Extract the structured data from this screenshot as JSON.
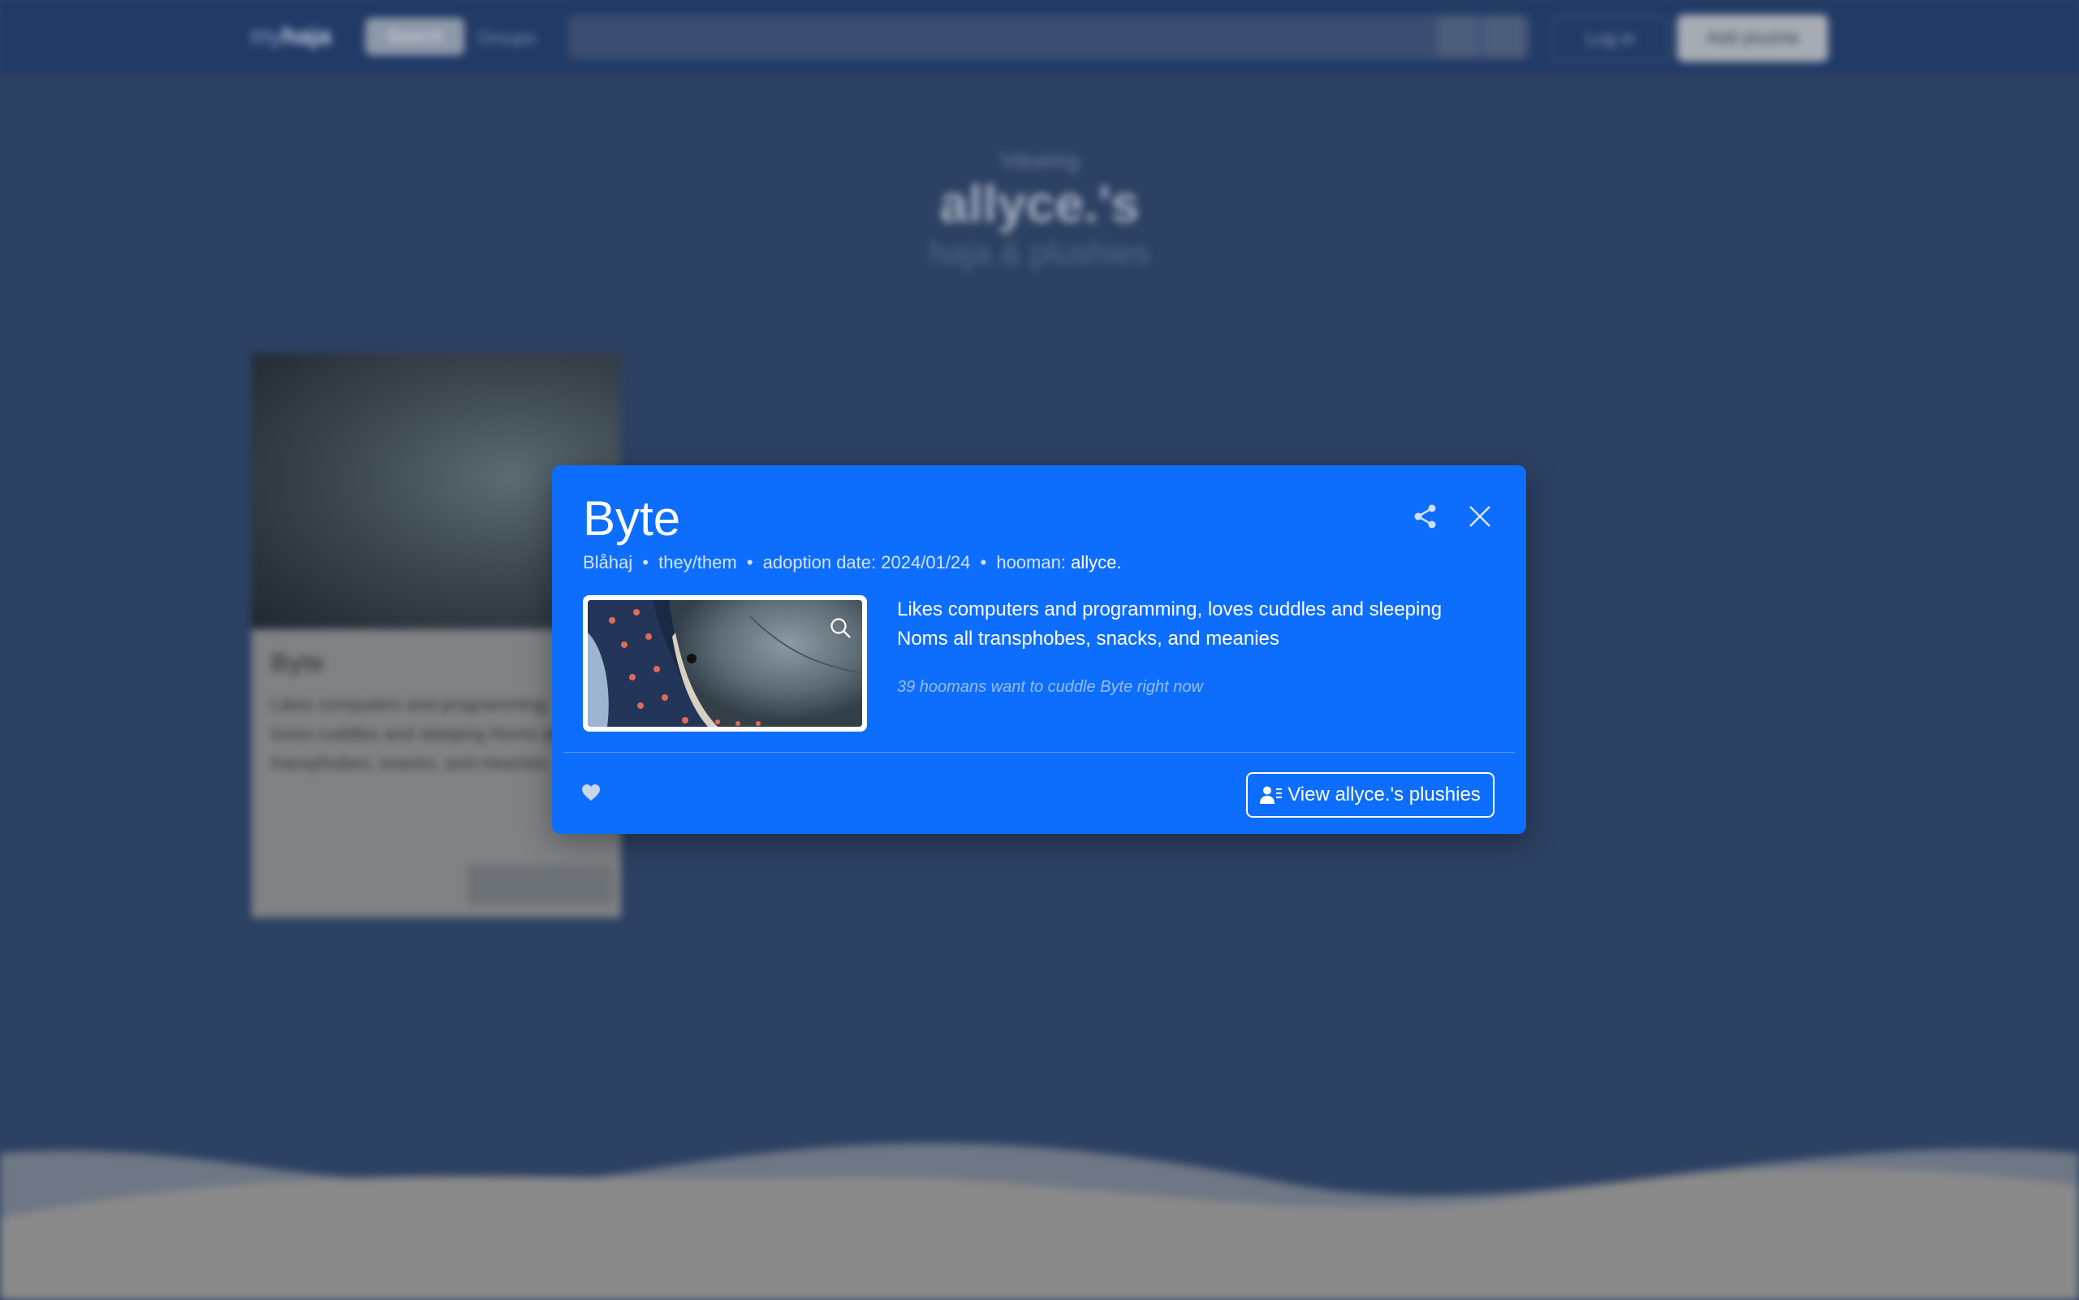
{
  "navbar": {
    "brand_prefix": "my",
    "brand_suffix": "haja",
    "active_tab": "Search",
    "second_tab": "Groups",
    "login_label": "Log in",
    "add_label": "Add plushie"
  },
  "hero": {
    "viewing": "Viewing",
    "owner_title": "allyce.'s",
    "subtitle": "haja & plushies"
  },
  "bg_card": {
    "name": "Byte",
    "description": "Likes computers and programming, loves cuddles and sleeping Noms all transphobes, snacks, and meanies"
  },
  "modal": {
    "name": "Byte",
    "species": "Blåhaj",
    "pronouns": "they/them",
    "adoption_label": "adoption date:",
    "adoption_date": "2024/01/24",
    "hooman_label": "hooman:",
    "hooman": "allyce.",
    "separator": "•",
    "description_lines": [
      "Likes computers and programming, loves cuddles and sleeping",
      "Noms all transphobes, snacks, and meanies"
    ],
    "cuddle_text": "39 hoomans want to cuddle Byte right now",
    "view_button_label": "View allyce.'s plushies",
    "icons": {
      "share": "share-icon",
      "close": "close-icon",
      "zoom": "search-icon",
      "heart": "heart-icon",
      "user_list": "user-list-icon"
    }
  },
  "colors": {
    "modal_bg": "#0d6efd",
    "page_bg": "#2d4163",
    "navbar_bg": "#213a66"
  }
}
